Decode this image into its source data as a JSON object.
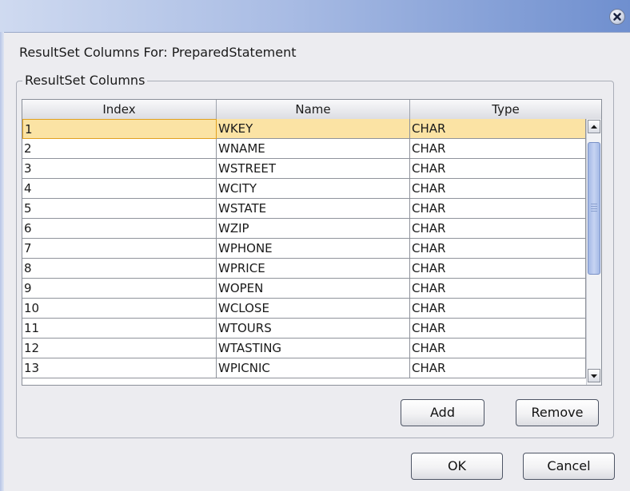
{
  "window": {
    "close_icon": "close-icon"
  },
  "dialog": {
    "heading": "ResultSet Columns For: PreparedStatement",
    "group_title": "ResultSet Columns"
  },
  "table": {
    "columns": [
      "Index",
      "Name",
      "Type"
    ],
    "rows": [
      {
        "index": "1",
        "name": "WKEY",
        "type": "CHAR"
      },
      {
        "index": "2",
        "name": "WNAME",
        "type": "CHAR"
      },
      {
        "index": "3",
        "name": "WSTREET",
        "type": "CHAR"
      },
      {
        "index": "4",
        "name": "WCITY",
        "type": "CHAR"
      },
      {
        "index": "5",
        "name": "WSTATE",
        "type": "CHAR"
      },
      {
        "index": "6",
        "name": "WZIP",
        "type": "CHAR"
      },
      {
        "index": "7",
        "name": "WPHONE",
        "type": "CHAR"
      },
      {
        "index": "8",
        "name": "WPRICE",
        "type": "CHAR"
      },
      {
        "index": "9",
        "name": "WOPEN",
        "type": "CHAR"
      },
      {
        "index": "10",
        "name": "WCLOSE",
        "type": "CHAR"
      },
      {
        "index": "11",
        "name": "WTOURS",
        "type": "CHAR"
      },
      {
        "index": "12",
        "name": "WTASTING",
        "type": "CHAR"
      },
      {
        "index": "13",
        "name": "WPICNIC",
        "type": "CHAR"
      }
    ],
    "selected_row": 0
  },
  "buttons": {
    "add": "Add",
    "remove": "Remove",
    "ok": "OK",
    "cancel": "Cancel"
  },
  "colors": {
    "selection": "#fbe3a4",
    "titlebar_end": "#6f8fcf"
  }
}
